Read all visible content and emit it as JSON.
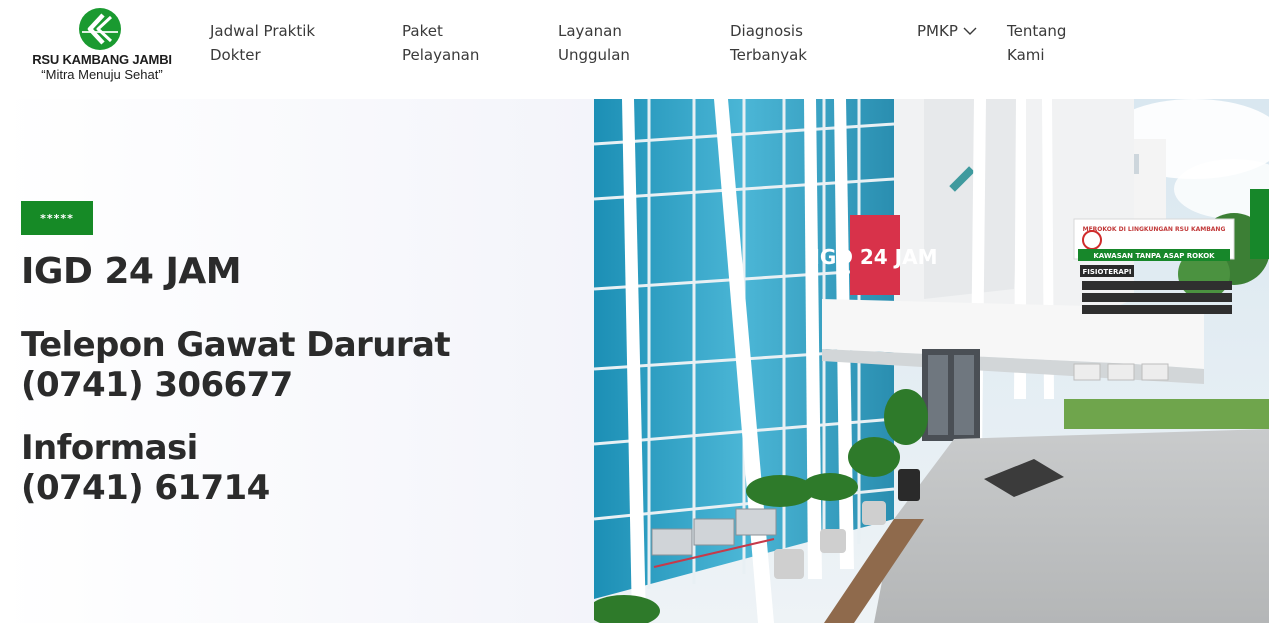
{
  "brand": {
    "name": "RSU KAMBANG JAMBI",
    "tagline": "“Mitra Menuju Sehat”",
    "logo_icon": "kambang-logo-icon",
    "color_green": "#168a26"
  },
  "nav": {
    "items": [
      {
        "line1": "Jadwal Praktik",
        "line2": "Dokter"
      },
      {
        "line1": "Paket",
        "line2": "Pelayanan"
      },
      {
        "line1": "Layanan",
        "line2": "Unggulan"
      },
      {
        "line1": "Diagnosis",
        "line2": "Terbanyak"
      },
      {
        "line1": "PMKP",
        "line2": "",
        "icon": "chevron-down-icon"
      },
      {
        "line1": "Tentang",
        "line2": "Kami"
      }
    ]
  },
  "hero": {
    "badge": "*****",
    "title": "IGD 24 JAM",
    "emergency": {
      "label": "Telepon Gawat Darurat",
      "phone": "(0741) 306677"
    },
    "info": {
      "label": "Informasi",
      "phone": "(0741) 61714"
    }
  },
  "photo": {
    "sign_igd": "IGD 24 JAM",
    "sign_fisioterapi": "FISIOTERAPI",
    "sign_no_smoking": "KAWASAN TANPA ASAP ROKOK",
    "sign_notice": "MEROKOK DI LINGKUNGAN RSU KAMBANG"
  }
}
